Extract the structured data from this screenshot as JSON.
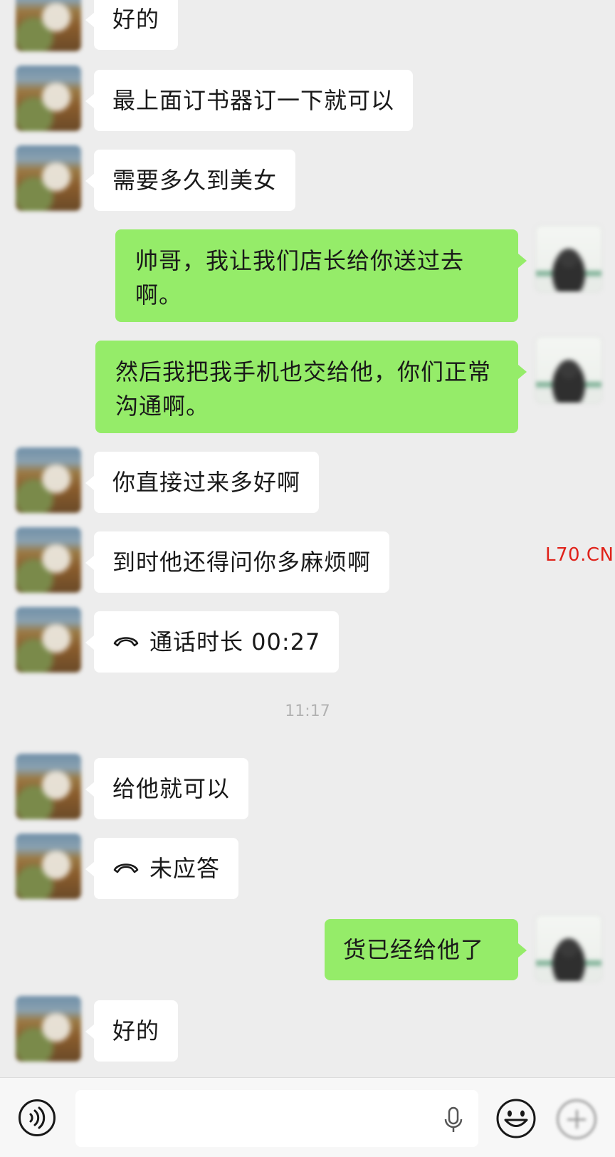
{
  "messages": [
    {
      "side": "left",
      "text": "好的"
    },
    {
      "side": "left",
      "text": "最上面订书器订一下就可以"
    },
    {
      "side": "left",
      "text": "需要多久到美女"
    },
    {
      "side": "right",
      "text": "帅哥，我让我们店长给你送过去啊。"
    },
    {
      "side": "right",
      "text": "然后我把我手机也交给他，你们正常沟通啊。"
    },
    {
      "side": "left",
      "text": "你直接过来多好啊"
    },
    {
      "side": "left",
      "text": "到时他还得问你多麻烦啊"
    },
    {
      "side": "left",
      "type": "call",
      "text": "通话时长 00:27"
    },
    {
      "side": "left",
      "text": "给他就可以"
    },
    {
      "side": "left",
      "type": "call",
      "text": "未应答"
    },
    {
      "side": "right",
      "text": "货已经给他了"
    },
    {
      "side": "left",
      "text": "好的"
    }
  ],
  "timestamp": "11:17",
  "watermark": "L70.CN",
  "input_bar": {
    "voice_icon": "voice-icon",
    "mic_icon": "microphone-icon",
    "emoji_icon": "emoji-icon",
    "plus_icon": "plus-icon"
  },
  "colors": {
    "background": "#ededed",
    "incoming_bubble": "#ffffff",
    "outgoing_bubble": "#95ec69",
    "watermark": "#e0221a"
  }
}
